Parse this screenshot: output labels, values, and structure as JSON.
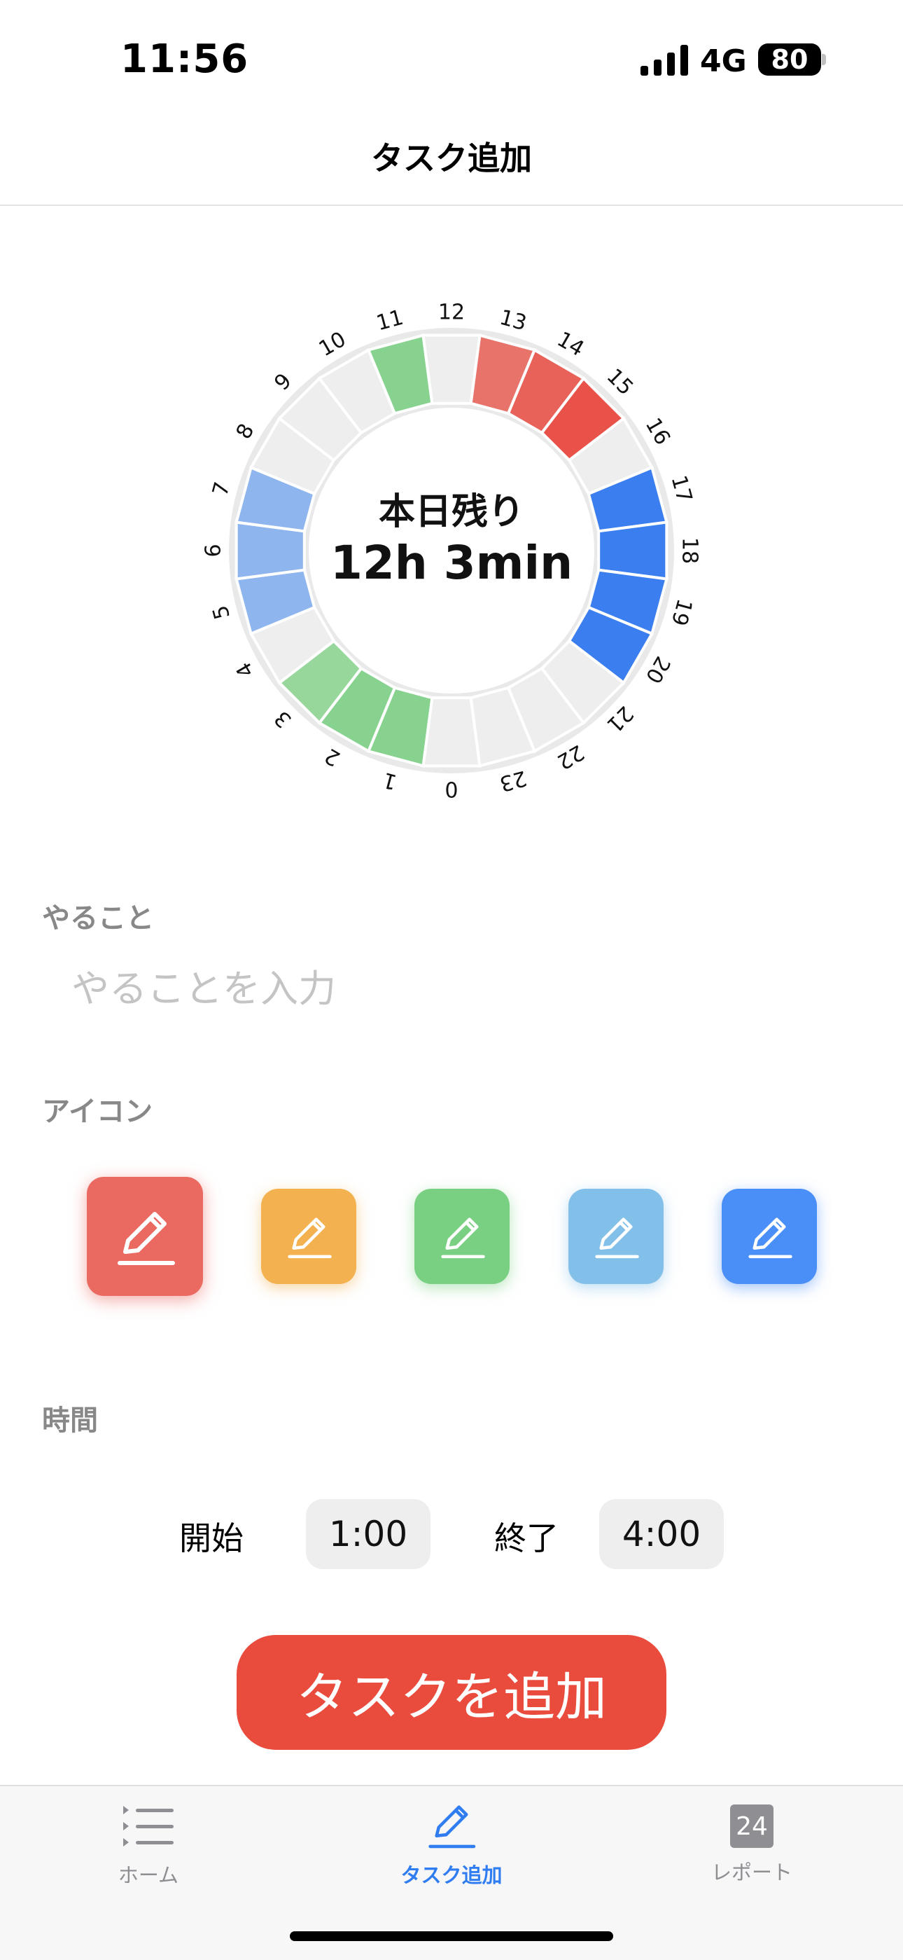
{
  "status_bar": {
    "time": "11:56",
    "network": "4G",
    "battery": "80"
  },
  "nav": {
    "title": "タスク追加"
  },
  "clock": {
    "center_line1": "本日残り",
    "center_line2": "12h 3min",
    "hour_labels": [
      "0",
      "1",
      "2",
      "3",
      "4",
      "5",
      "6",
      "7",
      "8",
      "9",
      "10",
      "11",
      "12",
      "13",
      "14",
      "15",
      "16",
      "17",
      "18",
      "19",
      "20",
      "21",
      "22",
      "23"
    ],
    "segment_colors": [
      "#eeeeee",
      "#87d28f",
      "#87d28f",
      "#98d79c",
      "#eeeeee",
      "#8fb5ef",
      "#8fb5ef",
      "#8fb5ef",
      "#eeeeee",
      "#eeeeee",
      "#eeeeee",
      "#87d28f",
      "#eeeeee",
      "#e8736b",
      "#e8625a",
      "#e85249",
      "#eeeeee",
      "#3a7ef0",
      "#3a7ef0",
      "#3a7ef0",
      "#3a7ef0",
      "#eeeeee",
      "#eeeeee",
      "#eeeeee"
    ]
  },
  "form": {
    "task_label": "やること",
    "task_placeholder": "やることを入力",
    "task_value": "",
    "icon_label": "アイコン",
    "icon_choices": [
      {
        "name": "pencil-icon",
        "color": "#ea6a62",
        "selected": true
      },
      {
        "name": "pencil-icon",
        "color": "#f3b14f",
        "selected": false
      },
      {
        "name": "pencil-icon",
        "color": "#79d082",
        "selected": false
      },
      {
        "name": "pencil-icon",
        "color": "#82c0e9",
        "selected": false
      },
      {
        "name": "pencil-icon",
        "color": "#4a8ef7",
        "selected": false
      }
    ],
    "time_label": "時間",
    "start_label": "開始",
    "start_value": "1:00",
    "end_label": "終了",
    "end_value": "4:00"
  },
  "add_button": {
    "label": "タスクを追加",
    "color": "#e94b3c"
  },
  "tabbar": {
    "items": [
      {
        "label": "ホーム",
        "icon": "list-icon",
        "active": false
      },
      {
        "label": "タスク追加",
        "icon": "pencil-icon",
        "active": true
      },
      {
        "label": "レポート",
        "icon": "calendar-icon",
        "badge": "24",
        "active": false
      }
    ],
    "active_color": "#2f7df1",
    "inactive_color": "#8e8e93"
  }
}
